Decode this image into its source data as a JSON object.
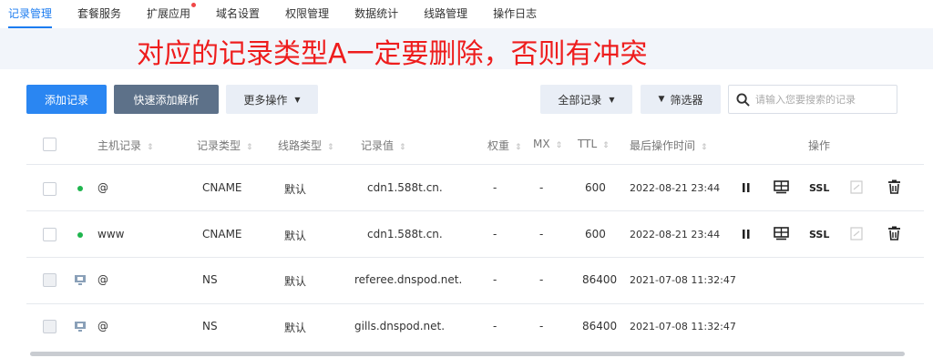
{
  "tabs": [
    {
      "label": "记录管理",
      "active": true
    },
    {
      "label": "套餐服务"
    },
    {
      "label": "扩展应用",
      "badge_dot": true
    },
    {
      "label": "域名设置"
    },
    {
      "label": "权限管理"
    },
    {
      "label": "数据统计"
    },
    {
      "label": "线路管理"
    },
    {
      "label": "操作日志"
    }
  ],
  "annotation": "对应的记录类型A一定要删除，否则有冲突",
  "toolbar": {
    "add_record": "添加记录",
    "quick_add": "快速添加解析",
    "more_actions": "更多操作",
    "all_records": "全部记录",
    "filter": "筛选器",
    "search_placeholder": "请输入您要搜索的记录"
  },
  "table": {
    "headers": {
      "host": "主机记录",
      "type": "记录类型",
      "line": "线路类型",
      "value": "记录值",
      "weight": "权重",
      "mx": "MX",
      "ttl": "TTL",
      "last_modified": "最后操作时间",
      "actions": "操作"
    },
    "rows": [
      {
        "host": "@",
        "type": "CNAME",
        "line": "默认",
        "value": "cdn1.588t.cn.",
        "weight": "-",
        "mx": "-",
        "ttl": "600",
        "last_modified": "2022-08-21 23:44",
        "ssl": "SSL"
      },
      {
        "host": "www",
        "type": "CNAME",
        "line": "默认",
        "value": "cdn1.588t.cn.",
        "weight": "-",
        "mx": "-",
        "ttl": "600",
        "last_modified": "2022-08-21 23:44",
        "ssl": "SSL"
      },
      {
        "host": "@",
        "type": "NS",
        "line": "默认",
        "value": "referee.dnspod.net.",
        "weight": "-",
        "mx": "-",
        "ttl": "86400",
        "last_modified": "2021-07-08 11:32:47"
      },
      {
        "host": "@",
        "type": "NS",
        "line": "默认",
        "value": "gills.dnspod.net.",
        "weight": "-",
        "mx": "-",
        "ttl": "86400",
        "last_modified": "2021-07-08 11:32:47"
      }
    ]
  },
  "colors": {
    "accent": "#2a86f2",
    "annotation_red": "#ee1d1d",
    "status_green": "#1fb54e"
  }
}
